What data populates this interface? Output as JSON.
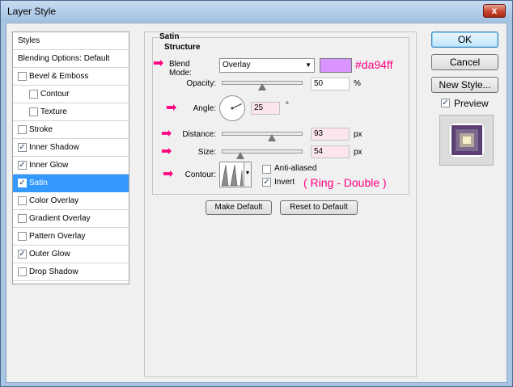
{
  "window": {
    "title": "Layer Style",
    "close_glyph": "x"
  },
  "styles_panel": {
    "header": "Styles",
    "items": [
      {
        "label": "Blending Options: Default",
        "checkbox": false,
        "checked": false,
        "indent": false,
        "selected": false
      },
      {
        "label": "Bevel & Emboss",
        "checkbox": true,
        "checked": false,
        "indent": false,
        "selected": false
      },
      {
        "label": "Contour",
        "checkbox": true,
        "checked": false,
        "indent": true,
        "selected": false
      },
      {
        "label": "Texture",
        "checkbox": true,
        "checked": false,
        "indent": true,
        "selected": false
      },
      {
        "label": "Stroke",
        "checkbox": true,
        "checked": false,
        "indent": false,
        "selected": false
      },
      {
        "label": "Inner Shadow",
        "checkbox": true,
        "checked": true,
        "indent": false,
        "selected": false
      },
      {
        "label": "Inner Glow",
        "checkbox": true,
        "checked": true,
        "indent": false,
        "selected": false
      },
      {
        "label": "Satin",
        "checkbox": true,
        "checked": true,
        "indent": false,
        "selected": true
      },
      {
        "label": "Color Overlay",
        "checkbox": true,
        "checked": false,
        "indent": false,
        "selected": false
      },
      {
        "label": "Gradient Overlay",
        "checkbox": true,
        "checked": false,
        "indent": false,
        "selected": false
      },
      {
        "label": "Pattern Overlay",
        "checkbox": true,
        "checked": false,
        "indent": false,
        "selected": false
      },
      {
        "label": "Outer Glow",
        "checkbox": true,
        "checked": true,
        "indent": false,
        "selected": false
      },
      {
        "label": "Drop Shadow",
        "checkbox": true,
        "checked": false,
        "indent": false,
        "selected": false
      }
    ]
  },
  "satin": {
    "group_title": "Satin",
    "structure_title": "Structure",
    "blend_mode": {
      "label": "Blend Mode:",
      "value": "Overlay",
      "color_swatch": "#da94ff",
      "color_note": "#da94ff"
    },
    "opacity": {
      "label": "Opacity:",
      "value": "50",
      "unit": "%",
      "level": 0.5
    },
    "angle": {
      "label": "Angle:",
      "value": "25",
      "unit": "°",
      "degrees": 25
    },
    "distance": {
      "label": "Distance:",
      "value": "93",
      "unit": "px",
      "level": 0.62
    },
    "size": {
      "label": "Size:",
      "value": "54",
      "unit": "px",
      "level": 0.22
    },
    "contour": {
      "label": "Contour:",
      "anti_aliased": {
        "label": "Anti-aliased",
        "checked": false
      },
      "invert": {
        "label": "Invert",
        "checked": true
      },
      "note": "( Ring - Double )"
    },
    "buttons": {
      "make_default": "Make Default",
      "reset_default": "Reset to Default"
    }
  },
  "right_panel": {
    "ok": "OK",
    "cancel": "Cancel",
    "new_style": "New Style...",
    "preview": {
      "label": "Preview",
      "checked": true
    }
  },
  "colors": {
    "accent_arrow": "#ff0080",
    "selection": "#3399ff",
    "field_fill": "#fde5ef"
  },
  "icons": {
    "arrow": "pink-right-arrow-icon",
    "checkmark": "check-icon"
  }
}
